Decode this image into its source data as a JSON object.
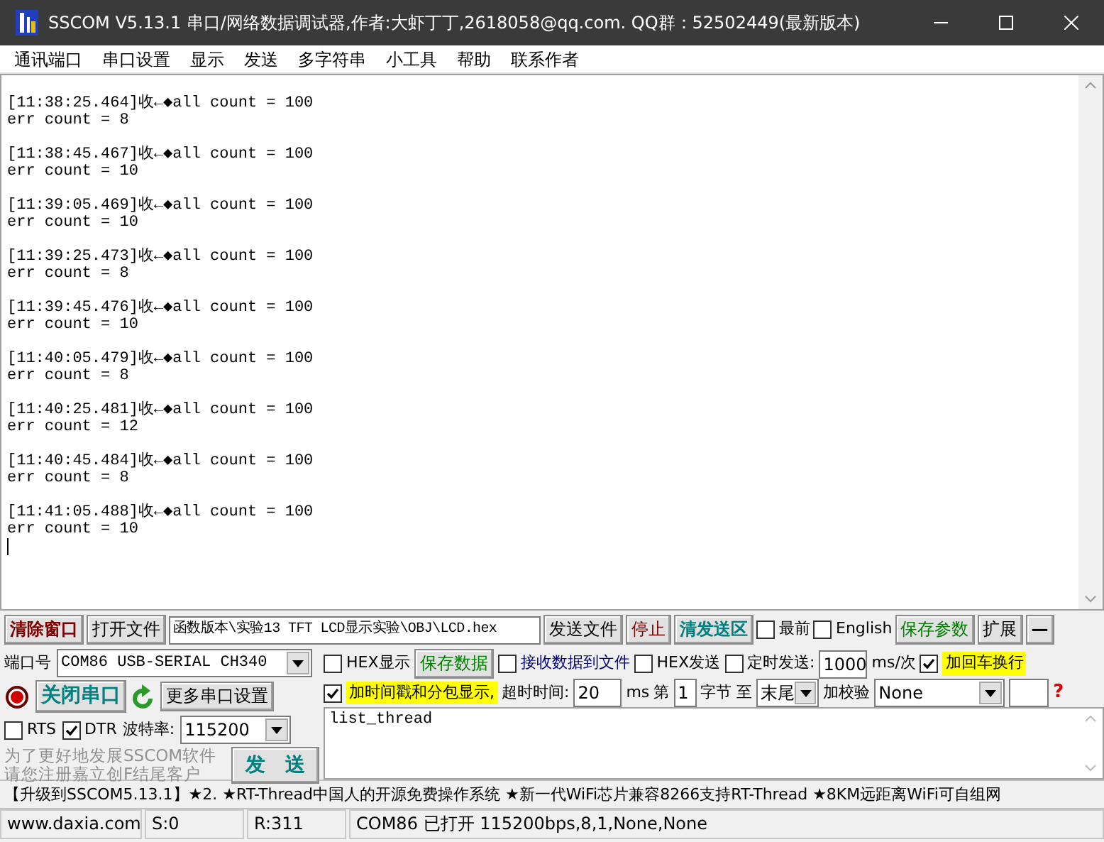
{
  "window": {
    "title": "SSCOM V5.13.1 串口/网络数据调试器,作者:大虾丁丁,2618058@qq.com. QQ群：52502449(最新版本)"
  },
  "menu": [
    "通讯端口",
    "串口设置",
    "显示",
    "发送",
    "多字符串",
    "小工具",
    "帮助",
    "联系作者"
  ],
  "log": {
    "entries": [
      {
        "lines": [
          "[11:38:25.464]收←◆all count = 100",
          "err count = 8"
        ]
      },
      {
        "lines": [
          "[11:38:45.467]收←◆all count = 100",
          "err count = 10"
        ]
      },
      {
        "lines": [
          "[11:39:05.469]收←◆all count = 100",
          "err count = 10"
        ]
      },
      {
        "lines": [
          "[11:39:25.473]收←◆all count = 100",
          "err count = 8"
        ]
      },
      {
        "lines": [
          "[11:39:45.476]收←◆all count = 100",
          "err count = 10"
        ]
      },
      {
        "lines": [
          "[11:40:05.479]收←◆all count = 100",
          "err count = 8"
        ]
      },
      {
        "lines": [
          "[11:40:25.481]收←◆all count = 100",
          "err count = 12"
        ]
      },
      {
        "lines": [
          "[11:40:45.484]收←◆all count = 100",
          "err count = 8"
        ]
      },
      {
        "lines": [
          "[11:41:05.488]收←◆all count = 100",
          "err count = 10"
        ]
      }
    ]
  },
  "top_row": [
    {
      "kind": "button",
      "label": "清除窗口",
      "color": "#800000",
      "bold": true
    },
    {
      "kind": "button",
      "label": "打开文件",
      "color": "#000000",
      "bold": false
    },
    {
      "kind": "field",
      "value": "函数版本\\实验13 TFT LCD显示实验\\OBJ\\LCD.hex"
    },
    {
      "kind": "button",
      "label": "发送文件",
      "color": "#000000",
      "bold": false
    },
    {
      "kind": "button",
      "label": "停止",
      "color": "#800000",
      "bold": false
    },
    {
      "kind": "button",
      "label": "清发送区",
      "color": "#008080",
      "bold": true
    },
    {
      "kind": "checkbox",
      "label": "最前",
      "checked": false,
      "highlighted": false,
      "color": "#000000"
    },
    {
      "kind": "checkbox",
      "label": "English",
      "checked": false,
      "highlighted": false,
      "color": "#000000"
    },
    {
      "kind": "button",
      "label": "保存参数",
      "color": "#008000",
      "bold": false
    },
    {
      "kind": "button",
      "label": "扩展",
      "color": "#000000",
      "bold": false
    },
    {
      "kind": "button",
      "label": "—",
      "color": "#000000",
      "bold": true
    }
  ],
  "port_panel": {
    "port_row": [
      {
        "kind": "label",
        "text": "端口号"
      },
      {
        "kind": "select",
        "value": "COM86 USB-SERIAL CH340",
        "mono": true
      }
    ],
    "control_row": [
      {
        "kind": "indicator"
      },
      {
        "kind": "button",
        "label": "关闭串口",
        "color": "#008080",
        "bold": true
      },
      {
        "kind": "refresh"
      },
      {
        "kind": "button",
        "label": "更多串口设置",
        "color": "#000000",
        "bold": false
      }
    ],
    "line_row": [
      {
        "kind": "checkbox",
        "label": "RTS",
        "checked": false,
        "highlighted": false,
        "color": "#000000"
      },
      {
        "kind": "checkbox",
        "label": "DTR",
        "checked": true,
        "highlighted": false,
        "color": "#000000"
      },
      {
        "kind": "label",
        "text": "波特率:"
      },
      {
        "kind": "select",
        "value": "115200",
        "mono": false
      }
    ],
    "notice": [
      "为了更好地发展SSCOM软件",
      "请您注册嘉立创F结尾客户"
    ],
    "send_button": {
      "label": "发　送",
      "color": "#008080",
      "bold": true
    }
  },
  "options": {
    "row_1": [
      {
        "kind": "checkbox",
        "label": "HEX显示",
        "checked": false,
        "highlighted": false,
        "color": "#000000"
      },
      {
        "kind": "button",
        "label": "保存数据",
        "color": "#008000",
        "bold": false
      },
      {
        "kind": "checkbox",
        "label": "接收数据到文件",
        "checked": false,
        "highlighted": false,
        "color": "#000080"
      },
      {
        "kind": "checkbox",
        "label": "HEX发送",
        "checked": false,
        "highlighted": false,
        "color": "#000000"
      },
      {
        "kind": "checkbox",
        "label": "定时发送:",
        "checked": false,
        "highlighted": false,
        "color": "#000000"
      },
      {
        "kind": "field",
        "value": "1000"
      },
      {
        "kind": "label",
        "text": "ms/次"
      },
      {
        "kind": "checkbox",
        "label": "加回车换行",
        "checked": true,
        "highlighted": true
      }
    ],
    "row_2": [
      {
        "kind": "checkbox",
        "label": "加时间戳和分包显示,",
        "checked": true,
        "highlighted": true
      },
      {
        "kind": "label",
        "text": "超时时间:"
      },
      {
        "kind": "field",
        "value": "20"
      },
      {
        "kind": "label",
        "text": "ms"
      },
      {
        "kind": "label",
        "text": "第"
      },
      {
        "kind": "field",
        "value": "1"
      },
      {
        "kind": "label",
        "text": "字节 至"
      },
      {
        "kind": "select",
        "value": "末尾",
        "mono": false
      },
      {
        "kind": "label",
        "text": "加校验"
      },
      {
        "kind": "select",
        "value": "None",
        "mono": false
      }
    ],
    "help_icon": "?"
  },
  "send_area": {
    "text": "list_thread"
  },
  "ticker": "【升级到SSCOM5.13.1】★2. ★RT-Thread中国人的开源免费操作系统 ★新一代WiFi芯片兼容8266支持RT-Thread ★8KM远距离WiFi可自组网",
  "status_bar": [
    "www.daxia.com",
    "S:0",
    "R:311",
    "COM86 已打开  115200bps,8,1,None,None"
  ]
}
